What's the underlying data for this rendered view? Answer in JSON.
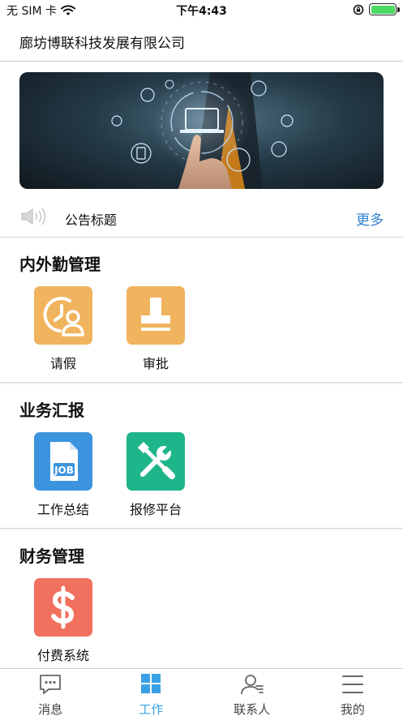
{
  "status_bar": {
    "carrier": "无 SIM 卡",
    "time": "下午4:43"
  },
  "header": {
    "title": "廊坊博联科技发展有限公司"
  },
  "notice": {
    "title": "公告标题",
    "more": "更多"
  },
  "sections": [
    {
      "title": "内外勤管理",
      "apps": [
        {
          "label": "请假",
          "icon": "clock-person-icon",
          "color": "#f0b35e"
        },
        {
          "label": "审批",
          "icon": "stamp-icon",
          "color": "#f0b35e"
        }
      ]
    },
    {
      "title": "业务汇报",
      "apps": [
        {
          "label": "工作总结",
          "icon": "job-document-icon",
          "color": "#3d94de"
        },
        {
          "label": "报修平台",
          "icon": "wrench-screwdriver-icon",
          "color": "#1fb58a"
        }
      ]
    },
    {
      "title": "财务管理",
      "apps": [
        {
          "label": "付费系统",
          "icon": "dollar-icon",
          "color": "#f2705e"
        }
      ]
    }
  ],
  "tabbar": [
    {
      "label": "消息",
      "icon": "message-icon",
      "active": false
    },
    {
      "label": "工作",
      "icon": "grid-icon",
      "active": true
    },
    {
      "label": "联系人",
      "icon": "contacts-icon",
      "active": false
    },
    {
      "label": "我的",
      "icon": "menu-icon",
      "active": false
    }
  ]
}
